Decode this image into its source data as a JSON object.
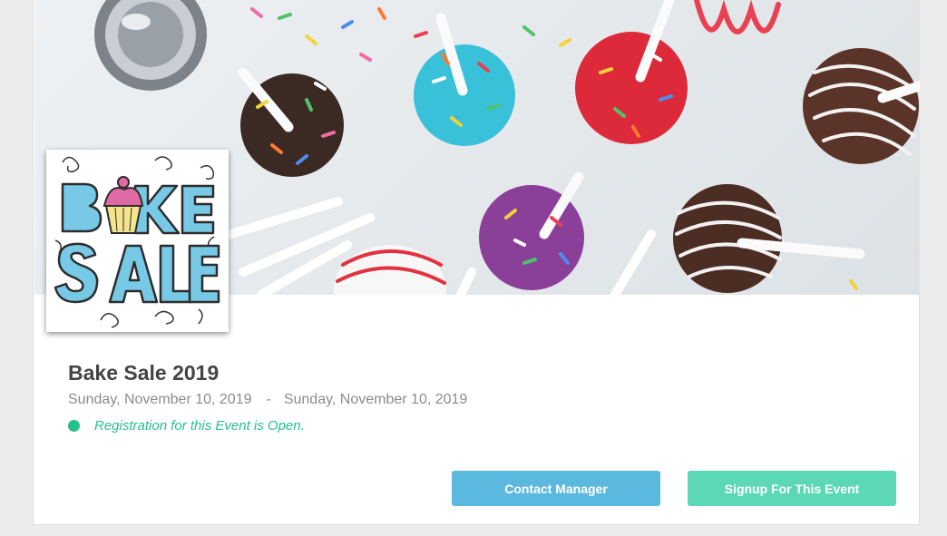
{
  "event": {
    "title": "Bake Sale 2019",
    "start_date": "Sunday, November 10, 2019",
    "date_separator": "-",
    "end_date": "Sunday, November 10, 2019",
    "registration_status": "Registration for this Event is Open."
  },
  "logo": {
    "word_top": "BAKE",
    "word_bottom": "SALE"
  },
  "actions": {
    "contact_label": "Contact Manager",
    "signup_label": "Signup For This Event"
  },
  "colors": {
    "status_open": "#26c08a",
    "contact_button": "#5bb9df",
    "signup_button": "#5cd8b6",
    "title_text": "#444444",
    "date_text": "#8c8c8c"
  }
}
